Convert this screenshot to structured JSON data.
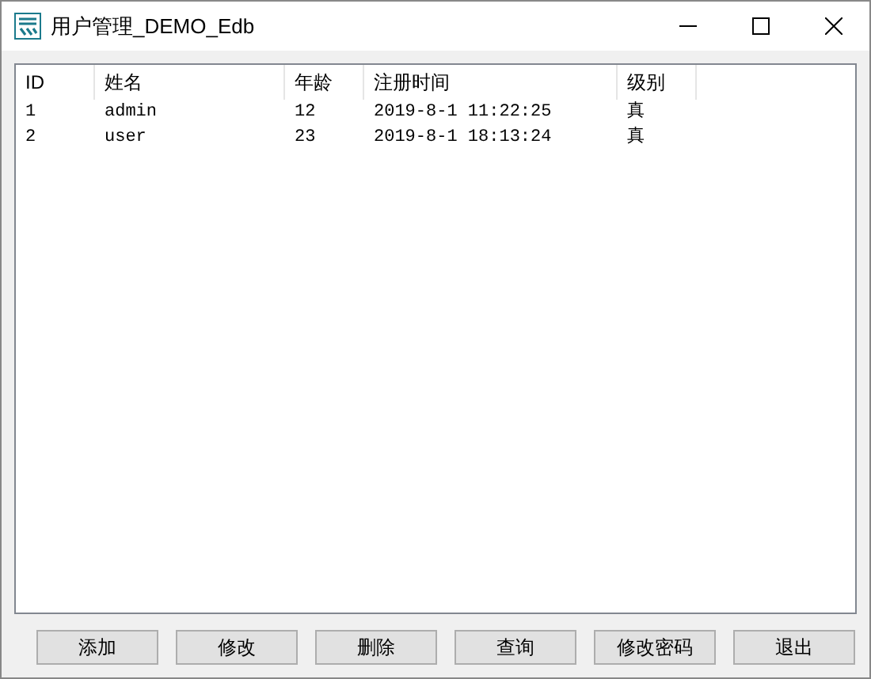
{
  "window": {
    "title": "用户管理_DEMO_Edb"
  },
  "table": {
    "columns": [
      "ID",
      "姓名",
      "年龄",
      "注册时间",
      "级别"
    ],
    "rows": [
      [
        "1",
        "admin",
        "12",
        "2019-8-1 11:22:25",
        "真"
      ],
      [
        "2",
        "user",
        "23",
        "2019-8-1 18:13:24",
        "真"
      ]
    ]
  },
  "buttons": [
    "添加",
    "修改",
    "删除",
    "查询",
    "修改密码",
    "退出"
  ]
}
